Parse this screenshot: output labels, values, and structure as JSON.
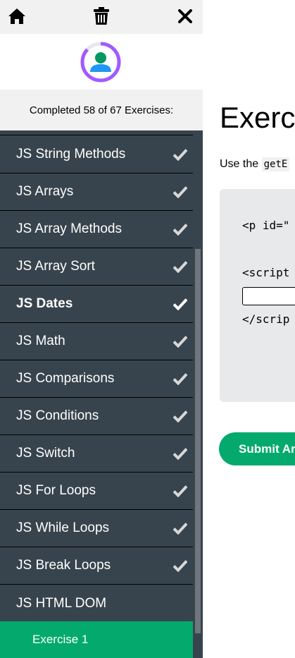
{
  "sidebar": {
    "progress_text": "Completed 58 of 67 Exercises:",
    "items": [
      {
        "label": "JS String Methods",
        "done": true
      },
      {
        "label": "JS Arrays",
        "done": true
      },
      {
        "label": "JS Array Methods",
        "done": true
      },
      {
        "label": "JS Array Sort",
        "done": true
      },
      {
        "label": "JS Dates",
        "done": true
      },
      {
        "label": "JS Math",
        "done": true
      },
      {
        "label": "JS Comparisons",
        "done": true
      },
      {
        "label": "JS Conditions",
        "done": true
      },
      {
        "label": "JS Switch",
        "done": true
      },
      {
        "label": "JS For Loops",
        "done": true
      },
      {
        "label": "JS While Loops",
        "done": true
      },
      {
        "label": "JS Break Loops",
        "done": true
      },
      {
        "label": "JS HTML DOM",
        "done": false
      }
    ],
    "active_exercise": "Exercise 1",
    "accent_color": "#04aa6d",
    "list_bg": "#38444d"
  },
  "main": {
    "heading": "Exerc",
    "instruction_prefix": "Use the ",
    "instruction_code": "getE",
    "code_line1": "<p id=\"",
    "code_line2": "<script",
    "code_line3": "</scrip",
    "submit_label": "Submit Ar"
  }
}
